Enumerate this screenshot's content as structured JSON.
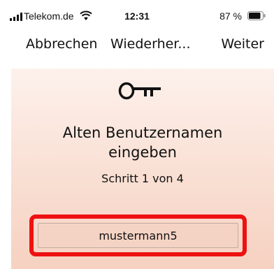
{
  "status_bar": {
    "carrier": "Telekom.de",
    "time": "12:31",
    "battery_percent": "87 %",
    "battery_level": 0.87,
    "signal_icon": "cellular-signal-icon",
    "wifi_icon": "wifi-icon",
    "battery_icon": "battery-icon"
  },
  "nav": {
    "cancel_label": "Abbrechen",
    "title": "Wiederher...",
    "next_label": "Weiter"
  },
  "content": {
    "icon": "key-icon",
    "heading_line1": "Alten Benutzernamen",
    "heading_line2": "eingeben",
    "step_text": "Schritt 1 von 4",
    "username_value": "mustermann5"
  },
  "colors": {
    "highlight_border": "#ee1111",
    "panel_top": "#fdf1ec",
    "panel_bottom": "#f6d1c1",
    "input_background": "#f5d3c4"
  }
}
